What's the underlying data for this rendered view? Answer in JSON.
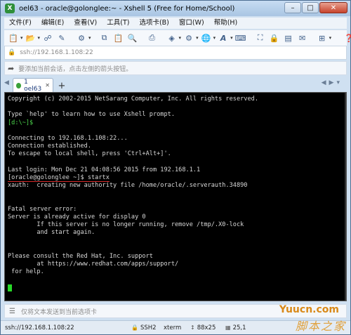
{
  "window": {
    "title": "oel63 - oracle@golonglee:~ - Xshell 5 (Free for Home/School)",
    "app_icon": "xshell-icon",
    "buttons": [
      "minimize",
      "maximize",
      "close"
    ]
  },
  "menu": [
    "文件(F)",
    "编辑(E)",
    "查看(V)",
    "工具(T)",
    "选项卡(B)",
    "窗口(W)",
    "帮助(H)"
  ],
  "toolbar": {
    "icons": [
      "new-session-icon",
      "open-folder-icon",
      "disconnect-icon",
      "reconnect-icon",
      "properties-icon",
      "copy-icon",
      "paste-icon",
      "find-icon",
      "print-icon",
      "color-scheme-icon",
      "transfer-icon",
      "globe-icon",
      "font-icon",
      "keyboard-icon",
      "fullscreen-icon",
      "lock-icon",
      "script-icon",
      "compose-icon",
      "new-tab-icon",
      "help-icon"
    ]
  },
  "address": {
    "value": "ssh://192.168.1.108:22"
  },
  "hint": {
    "text": "要添加当前会话，点击左侧的箭头按钮。"
  },
  "tabs": [
    {
      "label": "1 oel63",
      "active": true,
      "status_color": "#3aa13a"
    }
  ],
  "terminal": {
    "lines": [
      "Copyright (c) 2002-2015 NetSarang Computer, Inc. All rights reserved.",
      "",
      "Type `help' to learn how to use Xshell prompt.",
      "[d:\\~]$",
      "",
      "Connecting to 192.168.1.108:22...",
      "Connection established.",
      "To escape to local shell, press 'Ctrl+Alt+]'.",
      "",
      "Last login: Mon Dec 21 04:08:56 2015 from 192.168.1.1",
      "[oracle@golonglee ~]$ startx",
      "xauth:  creating new authority file /home/oracle/.serverauth.34890",
      "",
      "",
      "Fatal server error:",
      "Server is already active for display 0",
      "        If this server is no longer running, remove /tmp/.X0-lock",
      "        and start again.",
      "",
      "",
      "Please consult the Red Hat, Inc. support",
      "        at https://www.redhat.com/apps/support/",
      " for help.",
      "",
      ""
    ],
    "green_line_index": 3,
    "underlined_line_index": 10,
    "cursor_color": "#27d827"
  },
  "compose": {
    "text": "仅将文本发送到当前选项卡"
  },
  "status": {
    "address": "ssh://192.168.1.108:22",
    "protocol": "SSH2",
    "terminal": "xterm",
    "size": "88x25",
    "position": "25,1"
  },
  "watermark": {
    "line1": "Yuucn.com",
    "line2": "脚本之家"
  }
}
